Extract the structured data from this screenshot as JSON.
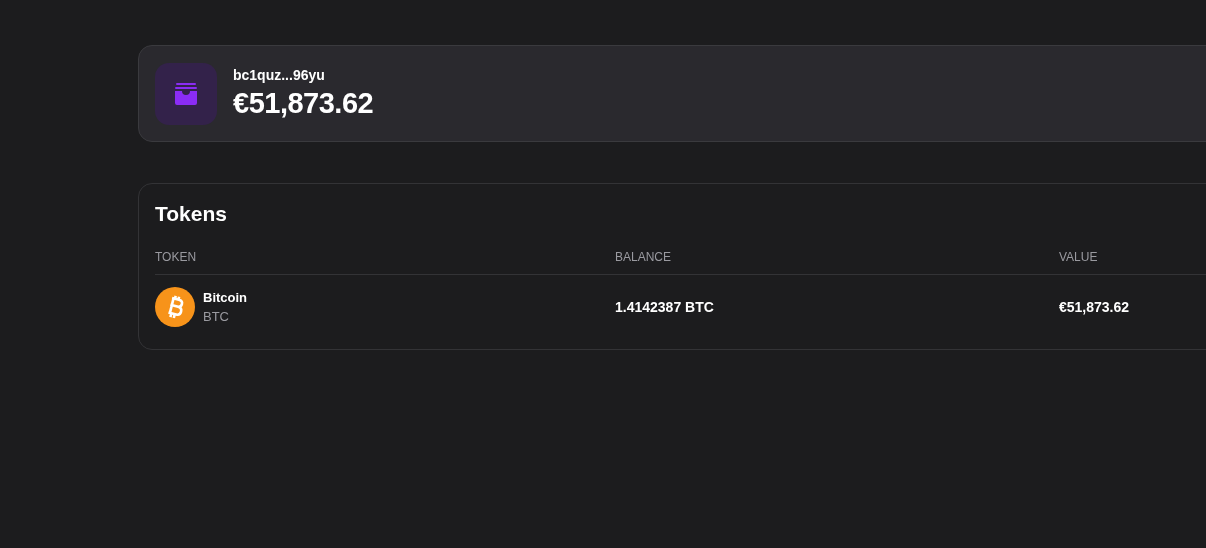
{
  "account": {
    "address": "bc1quz...96yu",
    "balance": "€51,873.62"
  },
  "tokens": {
    "title": "Tokens",
    "columns": [
      "TOKEN",
      "BALANCE",
      "VALUE"
    ],
    "rows": [
      {
        "name": "Bitcoin",
        "symbol": "BTC",
        "balance": "1.4142387 BTC",
        "value": "€51,873.62"
      }
    ]
  }
}
